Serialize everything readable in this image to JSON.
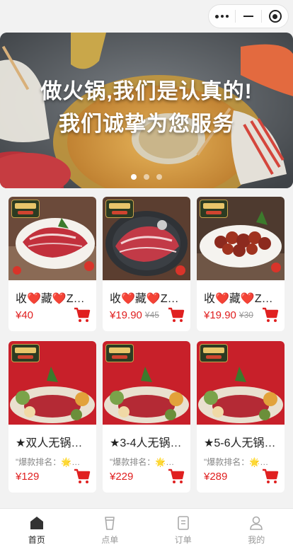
{
  "banner": {
    "line1": "做火锅,我们是认真的!",
    "line2": "我们诚挚为您服务",
    "slides": 3,
    "active_slide": 0
  },
  "products": [
    {
      "name": "收❤️藏❤️Z…",
      "desc": "",
      "price": "¥40",
      "old_price": "",
      "tall": false
    },
    {
      "name": "收❤️藏❤️Z…",
      "desc": "",
      "price": "¥19.90",
      "old_price": "¥45",
      "tall": false
    },
    {
      "name": "收❤️藏❤️Z…",
      "desc": "",
      "price": "¥19.90",
      "old_price": "¥30",
      "tall": false
    },
    {
      "name": "★双人无锅…",
      "desc": "\"爆款排名：🌟🌟…",
      "price": "¥129",
      "old_price": "",
      "tall": true
    },
    {
      "name": "★3-4人无锅…",
      "desc": "\"爆款排名：🌟🌟…",
      "price": "¥229",
      "old_price": "",
      "tall": true
    },
    {
      "name": "★5-6人无锅…",
      "desc": "\"爆款排名：🌟🌟…",
      "price": "¥289",
      "old_price": "",
      "tall": true
    }
  ],
  "tabbar": {
    "items": [
      {
        "label": "首页",
        "icon": "home-icon",
        "active": true
      },
      {
        "label": "点单",
        "icon": "cup-icon",
        "active": false
      },
      {
        "label": "订单",
        "icon": "receipt-icon",
        "active": false
      },
      {
        "label": "我的",
        "icon": "user-icon",
        "active": false
      }
    ]
  },
  "colors": {
    "accent": "#e02020",
    "text": "#222222",
    "muted": "#999999",
    "page_bg": "#f2f2f2"
  }
}
